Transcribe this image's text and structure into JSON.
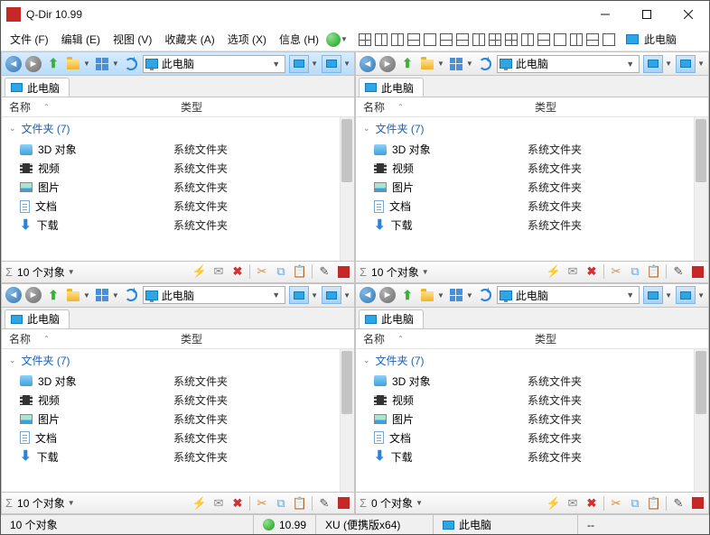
{
  "title": "Q-Dir 10.99",
  "menu": {
    "file": "文件 (F)",
    "edit": "编辑 (E)",
    "view": "视图 (V)",
    "fav": "收藏夹 (A)",
    "opt": "选项 (X)",
    "info": "信息 (H)",
    "tail": "此电脑"
  },
  "pane": {
    "addr_label": "此电脑",
    "tab_label": "此电脑",
    "col_name": "名称",
    "col_type": "类型",
    "group": "文件夹 (7)",
    "count": "10 个对象",
    "count_alt": "0 个对象",
    "type_sysfolder": "系统文件夹",
    "items": {
      "i3d": "3D 对象",
      "vid": "视频",
      "pic": "图片",
      "doc": "文档",
      "dl": "下载"
    }
  },
  "status": {
    "left": "10 个对象",
    "ver": "10.99",
    "xu": "XU (便携版x64)",
    "pc": "此电脑",
    "dash": "--"
  }
}
